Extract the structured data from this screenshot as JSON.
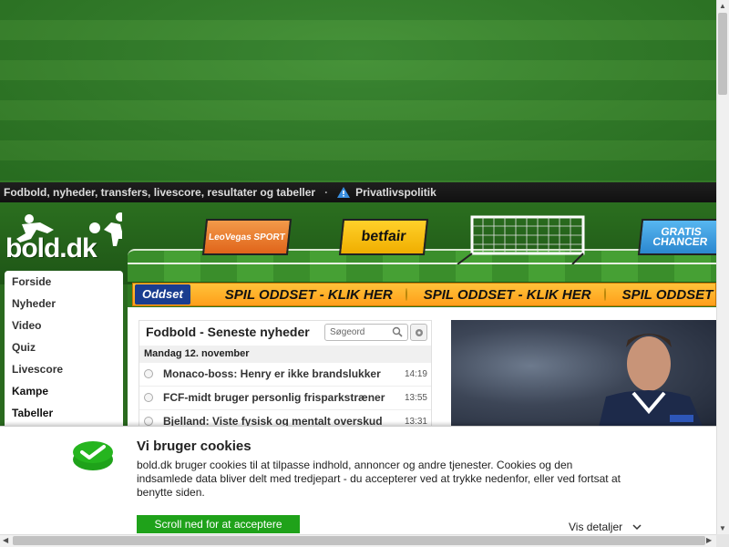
{
  "topbar": {
    "tagline": "Fodbold, nyheder, transfers, livescore, resultater og tabeller",
    "separator": "·",
    "privacy_link": "Privatlivspolitik"
  },
  "logo": {
    "text": "bold.dk"
  },
  "sponsors": {
    "leovegas": "LeoVegas SPORT",
    "betfair": "betfair",
    "gratis": "GRATIS CHANCER"
  },
  "sidebar": {
    "items": [
      {
        "label": "Forside"
      },
      {
        "label": "Nyheder"
      },
      {
        "label": "Video"
      },
      {
        "label": "Quiz"
      },
      {
        "label": "Livescore"
      },
      {
        "label": "Kampe"
      },
      {
        "label": "Tabeller"
      }
    ]
  },
  "oddset_banner": {
    "logo": "Oddset",
    "cta": "SPIL ODDSET - KLIK HER"
  },
  "news": {
    "header": "Fodbold - Seneste nyheder",
    "search_placeholder": "Søgeord",
    "date": "Mandag 12. november",
    "items": [
      {
        "title": "Monaco-boss: Henry er ikke brandslukker",
        "time": "14:19"
      },
      {
        "title": "FCF-midt bruger personlig frisparkstræner",
        "time": "13:55"
      },
      {
        "title": "Bjelland: Viste fysisk og mentalt overskud",
        "time": "13:31"
      }
    ]
  },
  "cookie": {
    "title": "Vi bruger cookies",
    "text": "bold.dk bruger cookies til at tilpasse indhold, annoncer og andre tjenester. Cookies og den indsamlede data bliver delt med tredjepart - du accepterer ved at trykke nedenfor, eller ved fortsat at benytte siden.",
    "accept_button": "Scroll ned for at acceptere",
    "details_link": "Vis detaljer"
  },
  "colors": {
    "accent_green": "#1fa21a",
    "oddset_orange": "#ff9f1a",
    "header_green": "#2b6f1f"
  }
}
